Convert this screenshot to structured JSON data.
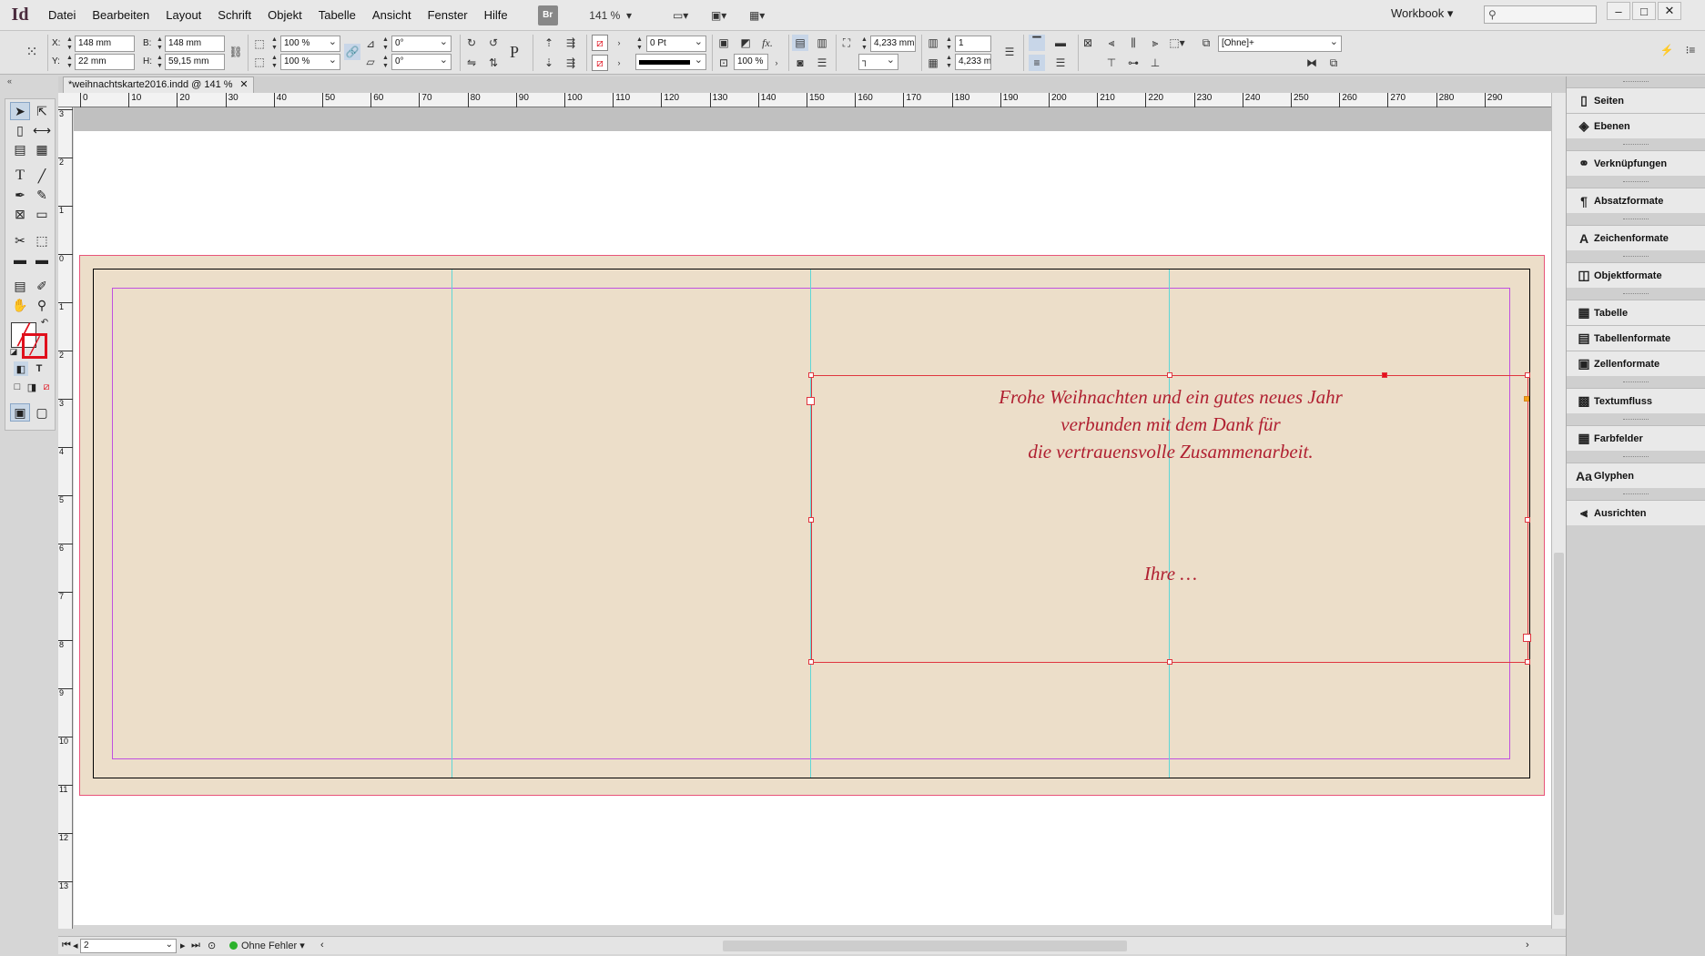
{
  "app": {
    "logo": "Id"
  },
  "menu": [
    "Datei",
    "Bearbeiten",
    "Layout",
    "Schrift",
    "Objekt",
    "Tabelle",
    "Ansicht",
    "Fenster",
    "Hilfe"
  ],
  "menubar": {
    "bridge": "Br",
    "zoom": "141 %",
    "workspace": "Workbook",
    "search_placeholder": ""
  },
  "control": {
    "x_label": "X:",
    "x": "148 mm",
    "y_label": "Y:",
    "y": "22 mm",
    "w_label": "B:",
    "w": "148 mm",
    "h_label": "H:",
    "h": "59,15 mm",
    "scale_x": "100 %",
    "scale_y": "100 %",
    "rotation": "0°",
    "shear": "0°",
    "stroke_weight": "0 Pt",
    "opacity": "100 %",
    "gap1": "4,233 mm",
    "columns": "1",
    "gap2": "4,233 m",
    "object_style": "[Ohne]+"
  },
  "document": {
    "tab": "*weihnachtskarte2016.indd @ 141 %"
  },
  "ruler": {
    "h": [
      "0",
      "10",
      "20",
      "30",
      "40",
      "50",
      "60",
      "70",
      "80",
      "90",
      "100",
      "110",
      "120",
      "130",
      "140",
      "150",
      "160",
      "170",
      "180",
      "190",
      "200",
      "210",
      "220",
      "230",
      "240",
      "250",
      "260",
      "270",
      "280",
      "290"
    ],
    "v": [
      "3",
      "2",
      "1",
      "0",
      "1",
      "2",
      "3",
      "4",
      "5",
      "6",
      "7",
      "8",
      "9",
      "10",
      "11",
      "12",
      "13"
    ]
  },
  "card": {
    "greeting": [
      "Frohe Weihnachten und ein gutes neues Jahr",
      "verbunden mit dem Dank für",
      "die vertrauensvolle Zusammenarbeit."
    ],
    "signoff": "Ihre …"
  },
  "status": {
    "page": "2",
    "preflight": "Ohne Fehler"
  },
  "panels": [
    {
      "label": "Seiten",
      "icon": "pages-icon"
    },
    {
      "label": "Ebenen",
      "icon": "layers-icon"
    },
    {
      "label": "Verknüpfungen",
      "icon": "links-icon"
    },
    {
      "label": "Absatzformate",
      "icon": "paragraph-styles-icon"
    },
    {
      "label": "Zeichenformate",
      "icon": "character-styles-icon"
    },
    {
      "label": "Objektformate",
      "icon": "object-styles-icon"
    },
    {
      "label": "Tabelle",
      "icon": "table-icon"
    },
    {
      "label": "Tabellenformate",
      "icon": "table-styles-icon"
    },
    {
      "label": "Zellenformate",
      "icon": "cell-styles-icon"
    },
    {
      "label": "Textumfluss",
      "icon": "text-wrap-icon"
    },
    {
      "label": "Farbfelder",
      "icon": "swatches-icon"
    },
    {
      "label": "Glyphen",
      "icon": "glyphs-icon"
    },
    {
      "label": "Ausrichten",
      "icon": "align-icon"
    }
  ],
  "colors": {
    "paper": "#ecdec9",
    "bleed": "#e8547a",
    "margin": "#c050e0",
    "guide": "#5fd6d6",
    "frame": "#e0353f",
    "text": "#b02031"
  }
}
